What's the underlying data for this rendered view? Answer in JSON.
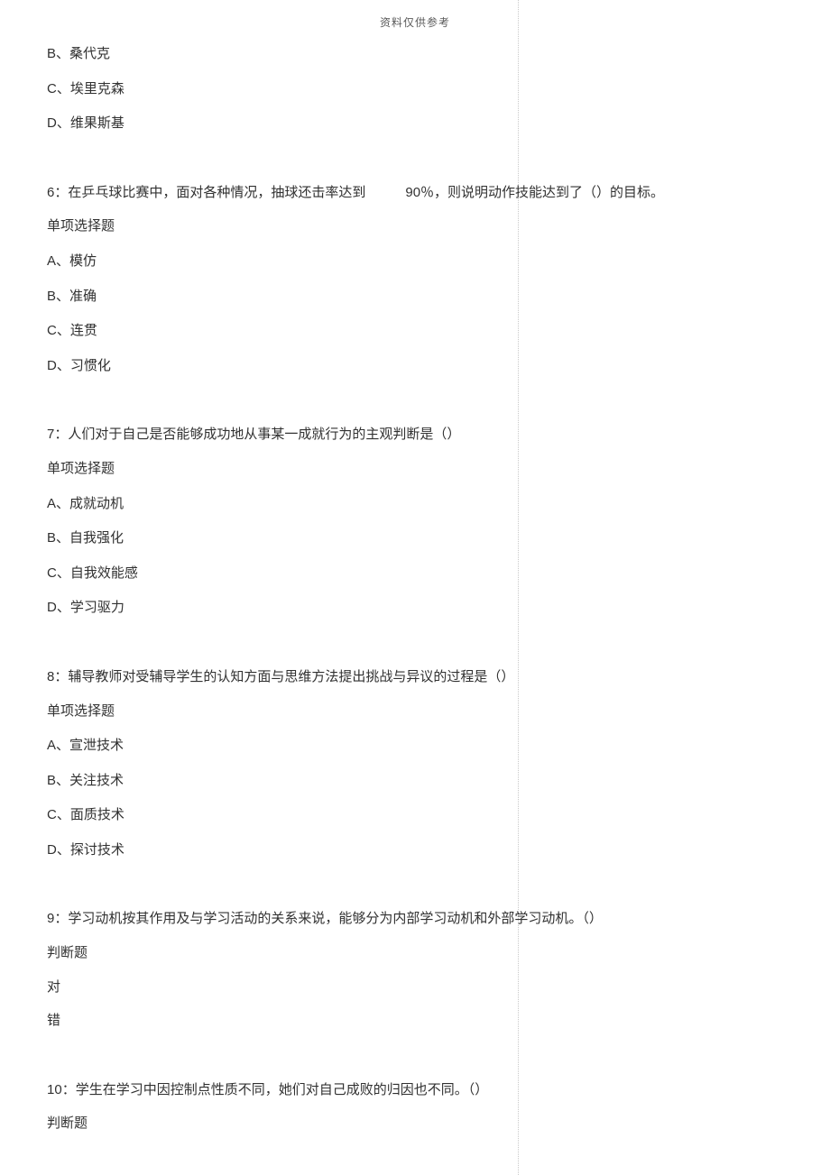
{
  "header": "资料仅供参考",
  "q5_options": {
    "b": "B、桑代克",
    "c": "C、埃里克森",
    "d": "D、维果斯基"
  },
  "q6": {
    "stem_a": "6：在乒乓球比赛中，面对各种情况，抽球还击率达到",
    "stem_b": "90％，则说明动作技能达到了（）的目标。",
    "type": "单项选择题",
    "a": "A、模仿",
    "b": "B、准确",
    "c": "C、连贯",
    "d": "D、习惯化"
  },
  "q7": {
    "stem": "7：人们对于自己是否能够成功地从事某一成就行为的主观判断是（）",
    "type": "单项选择题",
    "a": "A、成就动机",
    "b": "B、自我强化",
    "c": "C、自我效能感",
    "d": "D、学习驱力"
  },
  "q8": {
    "stem": "8：辅导教师对受辅导学生的认知方面与思维方法提出挑战与异议的过程是（）",
    "type": "单项选择题",
    "a": "A、宣泄技术",
    "b": "B、关注技术",
    "c": "C、面质技术",
    "d": "D、探讨技术"
  },
  "q9": {
    "stem": "9：学习动机按其作用及与学习活动的关系来说，能够分为内部学习动机和外部学习动机。（）",
    "type": "判断题",
    "t": "对",
    "f": "错"
  },
  "q10": {
    "stem": "10：学生在学习中因控制点性质不同，她们对自己成败的归因也不同。（）",
    "type": "判断题"
  }
}
